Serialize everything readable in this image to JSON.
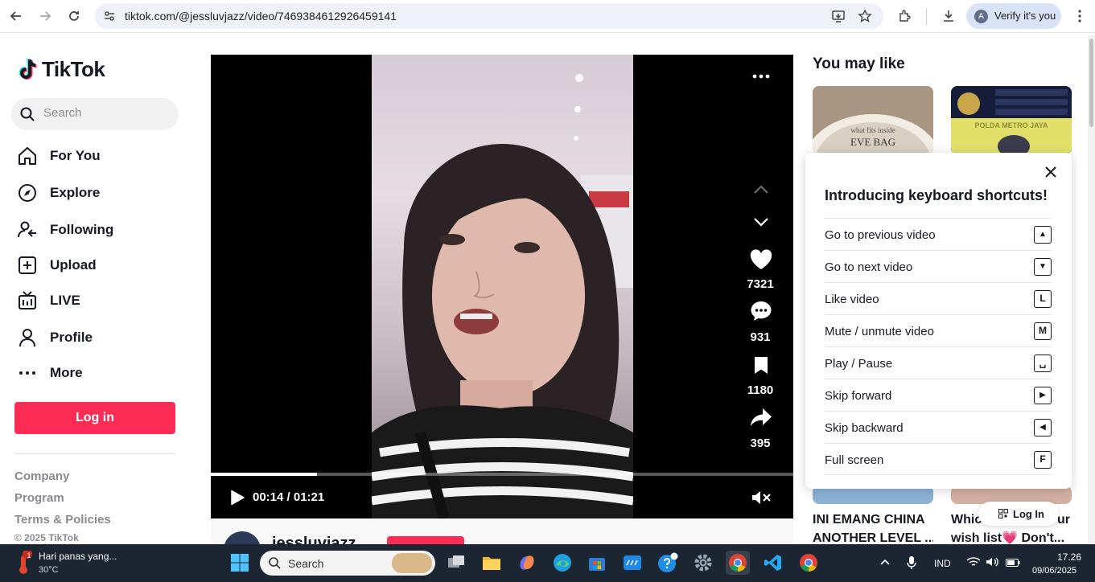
{
  "browser": {
    "url": "tiktok.com/@jessluvjazz/video/7469384612926459141",
    "verify_label": "Verify it's you",
    "avatar_letter": "A"
  },
  "sidebar": {
    "brand": "TikTok",
    "search_placeholder": "Search",
    "items": [
      {
        "label": "For You",
        "icon": "home-icon"
      },
      {
        "label": "Explore",
        "icon": "compass-icon"
      },
      {
        "label": "Following",
        "icon": "following-icon"
      },
      {
        "label": "Upload",
        "icon": "upload-icon"
      },
      {
        "label": "LIVE",
        "icon": "live-icon"
      },
      {
        "label": "Profile",
        "icon": "profile-icon"
      },
      {
        "label": "More",
        "icon": "more-dots-icon"
      }
    ],
    "login_label": "Log in",
    "footer_links": [
      "Company",
      "Program",
      "Terms & Policies"
    ],
    "copyright": "© 2025 TikTok"
  },
  "player": {
    "likes": "7321",
    "comments": "931",
    "saves": "1180",
    "shares": "395",
    "time": "00:14 / 01:21",
    "progress": 0.183,
    "username": "jessluvjazz"
  },
  "recommendations": {
    "heading": "You may like",
    "thumb1_text": "EVE BAG",
    "thumb1_sub": "what fits inside",
    "thumb2_text": "POLDA METRO JAYA",
    "caption1_line1": "INI EMANG CHINA",
    "caption1_line2": "ANOTHER LEVEL ...",
    "caption2_line1": "Whic",
    "caption2_line1_end": "ur",
    "caption2_line2": "wish list💗 Don't...",
    "login_pill": "Log In"
  },
  "shortcuts": {
    "title": "Introducing keyboard shortcuts!",
    "rows": [
      {
        "label": "Go to previous video",
        "key": "▲"
      },
      {
        "label": "Go to next video",
        "key": "▼"
      },
      {
        "label": "Like video",
        "key": "L"
      },
      {
        "label": "Mute / unmute video",
        "key": "M"
      },
      {
        "label": "Play / Pause",
        "key": "␣"
      },
      {
        "label": "Skip forward",
        "key": "▶"
      },
      {
        "label": "Skip backward",
        "key": "◀"
      },
      {
        "label": "Full screen",
        "key": "F"
      }
    ]
  },
  "taskbar": {
    "weather_title": "Hari panas yang...",
    "weather_temp": "30°C",
    "weather_badge": "1",
    "search_label": "Search",
    "lang": "IND",
    "time": "17.26",
    "date": "09/06/2025"
  },
  "colors": {
    "accent": "#fe2c55",
    "text": "#161823",
    "muted": "#8a8b91"
  }
}
